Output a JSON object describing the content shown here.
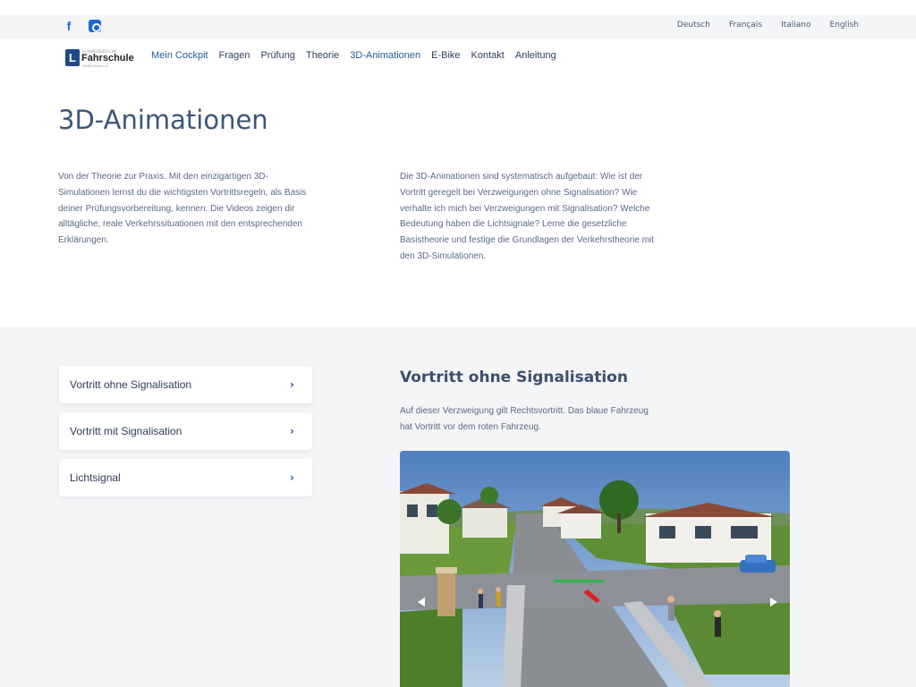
{
  "social": {
    "facebook_glyph": "f",
    "facebook_icon": "facebook-icon",
    "instagram_icon": "instagram-icon"
  },
  "languages": [
    "Deutsch",
    "Français",
    "Italiano",
    "English"
  ],
  "logo": {
    "mark": "L",
    "top_text": "SCHWEIZERISCHE",
    "text": "Fahrschule",
    "sub_text": "FAHRSCHULE.CH"
  },
  "nav": {
    "items": [
      {
        "label": "Mein Cockpit",
        "highlight": true
      },
      {
        "label": "Fragen",
        "highlight": false
      },
      {
        "label": "Prüfung",
        "highlight": false
      },
      {
        "label": "Theorie",
        "highlight": false
      },
      {
        "label": "3D-Animationen",
        "highlight": true
      },
      {
        "label": "E-Bike",
        "highlight": false
      },
      {
        "label": "Kontakt",
        "highlight": false
      },
      {
        "label": "Anleitung",
        "highlight": false
      }
    ]
  },
  "page": {
    "title": "3D-Animationen",
    "intro_left": "Von der Theorie zur Praxis. Mit den einzigartigen 3D-Simulationen lernst du die wichtigsten Vortrittsregeln, als Basis deiner Prüfungsvorbereitung, kennen. Die Videos zeigen dir alltägliche, reale Verkehrssituationen mit den entsprechenden Erklärungen.",
    "intro_right": "Die 3D-Animationen sind systematisch aufgebaut: Wie ist der Vortritt geregelt bei Verzweigungen ohne Signalisation? Wie verhalte ich mich bei Verzweigungen mit Signalisation? Welche Bedeutung haben die Lichtsignale? Lerne die gesetzliche Basistheorie und festige die Grundlagen der Verkehrstheorie mit den 3D-Simulationen."
  },
  "topics": [
    {
      "label": "Vortritt ohne Signalisation",
      "chevron": "›"
    },
    {
      "label": "Vortritt mit Signalisation",
      "chevron": "›"
    },
    {
      "label": "Lichtsignal",
      "chevron": "›"
    }
  ],
  "section": {
    "title": "Vortritt ohne Signalisation",
    "description": "Auf dieser Verzweigung gilt Rechtsvortritt. Das blaue Fahrzeug hat Vortritt vor dem roten Fahrzeug."
  },
  "video": {
    "prev_icon": "play-left-icon",
    "next_icon": "play-right-icon"
  },
  "colors": {
    "accent": "#1e5a96",
    "title": "#3c5677",
    "panel_bg": "#f4f5f7"
  }
}
